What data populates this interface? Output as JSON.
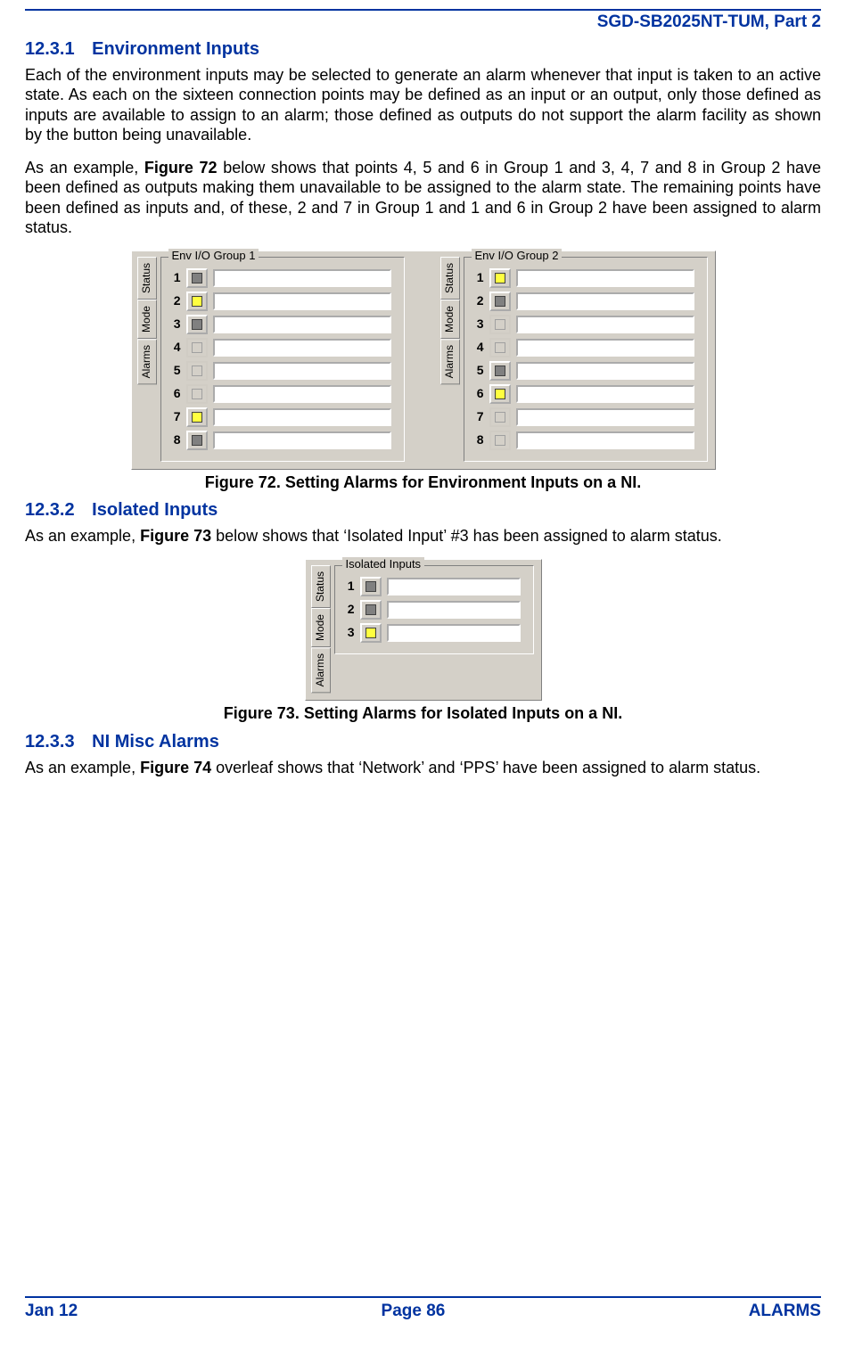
{
  "header": {
    "docCode": "SGD-SB2025NT-TUM, Part 2"
  },
  "sections": {
    "s1": {
      "num": "12.3.1",
      "title": "Environment Inputs"
    },
    "s2": {
      "num": "12.3.2",
      "title": "Isolated Inputs"
    },
    "s3": {
      "num": "12.3.3",
      "title": "NI Misc Alarms"
    }
  },
  "paras": {
    "p1": "Each of the environment inputs may be selected to generate an alarm whenever that input is taken to an active state.  As each on the sixteen connection points may be defined as an input or an output, only those defined as inputs are available to assign to an alarm; those defined as outputs do not support the alarm facility as shown by the button being unavailable.",
    "p2a": "As an example, ",
    "p2b": "Figure 72",
    "p2c": " below shows that points 4, 5 and 6 in Group 1 and 3, 4, 7 and 8 in Group 2 have been defined as outputs making them unavailable to be assigned to the alarm state.  The remaining points have been defined as inputs and, of these, 2 and 7 in Group 1 and 1 and 6 in Group 2 have been assigned to alarm status.",
    "p3a": "As an example, ",
    "p3b": "Figure 73",
    "p3c": " below shows that ‘Isolated Input’ #3 has been assigned to alarm status.",
    "p4a": "As an example, ",
    "p4b": "Figure 74",
    "p4c": " overleaf shows that ‘Network’ and ‘PPS’ have been assigned to alarm status."
  },
  "figcaps": {
    "f72": "Figure 72.  Setting Alarms for Environment Inputs on a NI.",
    "f73": "Figure 73.  Setting Alarms for Isolated Inputs on a NI."
  },
  "tabs": {
    "status": "Status",
    "mode": "Mode",
    "alarms": "Alarms"
  },
  "panels": {
    "g1": {
      "legend": "Env I/O Group 1",
      "rows": [
        {
          "n": "1",
          "state": "off"
        },
        {
          "n": "2",
          "state": "on"
        },
        {
          "n": "3",
          "state": "off"
        },
        {
          "n": "4",
          "state": "dis"
        },
        {
          "n": "5",
          "state": "dis"
        },
        {
          "n": "6",
          "state": "dis"
        },
        {
          "n": "7",
          "state": "on"
        },
        {
          "n": "8",
          "state": "off"
        }
      ]
    },
    "g2": {
      "legend": "Env I/O Group 2",
      "rows": [
        {
          "n": "1",
          "state": "on"
        },
        {
          "n": "2",
          "state": "off"
        },
        {
          "n": "3",
          "state": "dis"
        },
        {
          "n": "4",
          "state": "dis"
        },
        {
          "n": "5",
          "state": "off"
        },
        {
          "n": "6",
          "state": "on"
        },
        {
          "n": "7",
          "state": "dis"
        },
        {
          "n": "8",
          "state": "dis"
        }
      ]
    },
    "iso": {
      "legend": "Isolated Inputs",
      "rows": [
        {
          "n": "1",
          "state": "off"
        },
        {
          "n": "2",
          "state": "off"
        },
        {
          "n": "3",
          "state": "on"
        }
      ]
    }
  },
  "footer": {
    "left": "Jan 12",
    "center": "Page 86",
    "right": "ALARMS"
  }
}
